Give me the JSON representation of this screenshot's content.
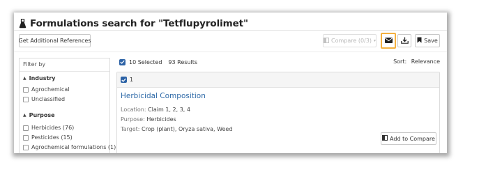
{
  "header": {
    "title": "Formulations search for \"Tetflupyrolimet\""
  },
  "toolbar": {
    "get_refs_label": "Get Additional References",
    "compare_label": "Compare (0/3)",
    "save_label": "Save"
  },
  "sidebar": {
    "filter_by": "Filter by",
    "sections": [
      {
        "title": "Industry",
        "items": [
          "Agrochemical",
          "Unclassified"
        ]
      },
      {
        "title": "Purpose",
        "items": [
          "Herbicides (76)",
          "Pesticides (15)",
          "Agrochemical formulations (1)"
        ]
      }
    ]
  },
  "results": {
    "selected": "10 Selected",
    "count": "93 Results",
    "sort_label": "Sort:",
    "sort_value": "Relevance"
  },
  "card": {
    "index": "1",
    "title": "Herbicidal Composition",
    "location_label": "Location:",
    "location": "Claim 1, 2, 3, 4",
    "purpose_label": "Purpose:",
    "purpose": "Herbicides",
    "target_label": "Target:",
    "target": "Crop (plant), Oryza sativa, Weed",
    "add_label": "Add to Compare"
  },
  "colors": {
    "accent_blue": "#2f6aa8",
    "checkbox_blue": "#2c62a6",
    "highlight_orange": "#f4b03f"
  }
}
